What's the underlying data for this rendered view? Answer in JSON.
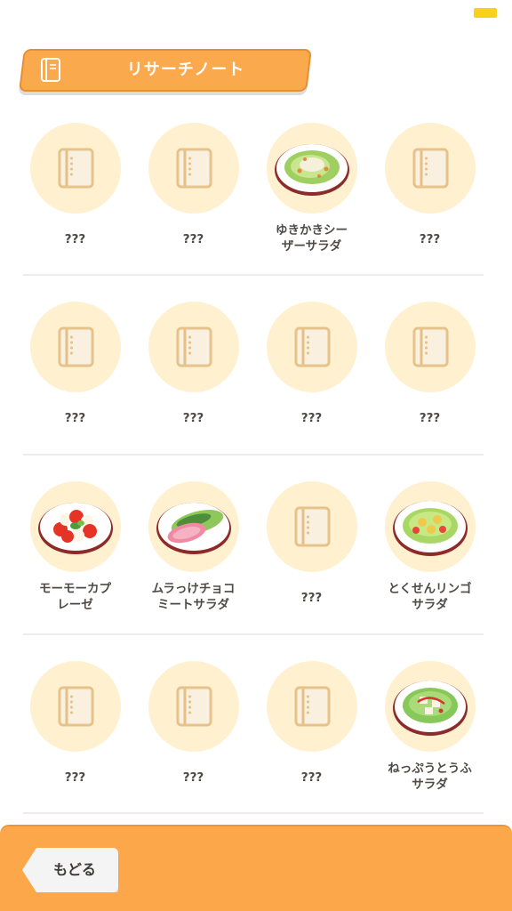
{
  "status_bar": {
    "battery_color": "#f8d21a"
  },
  "header": {
    "title": "リサーチノート",
    "icon": "notebook-icon"
  },
  "grid": {
    "rows": [
      [
        {
          "label": "???",
          "discovered": false
        },
        {
          "label": "???",
          "discovered": false
        },
        {
          "label": "ゆきかきシー\nザーサラダ",
          "discovered": true,
          "dish": "caesar-salad"
        },
        {
          "label": "???",
          "discovered": false
        }
      ],
      [
        {
          "label": "???",
          "discovered": false
        },
        {
          "label": "???",
          "discovered": false
        },
        {
          "label": "???",
          "discovered": false
        },
        {
          "label": "???",
          "discovered": false
        }
      ],
      [
        {
          "label": "モーモーカプ\nレーゼ",
          "discovered": true,
          "dish": "caprese"
        },
        {
          "label": "ムラっけチョコ\nミートサラダ",
          "discovered": true,
          "dish": "meat-salad"
        },
        {
          "label": "???",
          "discovered": false
        },
        {
          "label": "とくせんリンゴ\nサラダ",
          "discovered": true,
          "dish": "apple-salad"
        }
      ],
      [
        {
          "label": "???",
          "discovered": false
        },
        {
          "label": "???",
          "discovered": false
        },
        {
          "label": "???",
          "discovered": false
        },
        {
          "label": "ねっぷうとうふ\nサラダ",
          "discovered": true,
          "dish": "tofu-salad"
        }
      ]
    ]
  },
  "footer": {
    "back_label": "もどる"
  },
  "colors": {
    "accent": "#fba94d",
    "circle": "#fff0cf",
    "book": "#e9c48a"
  }
}
